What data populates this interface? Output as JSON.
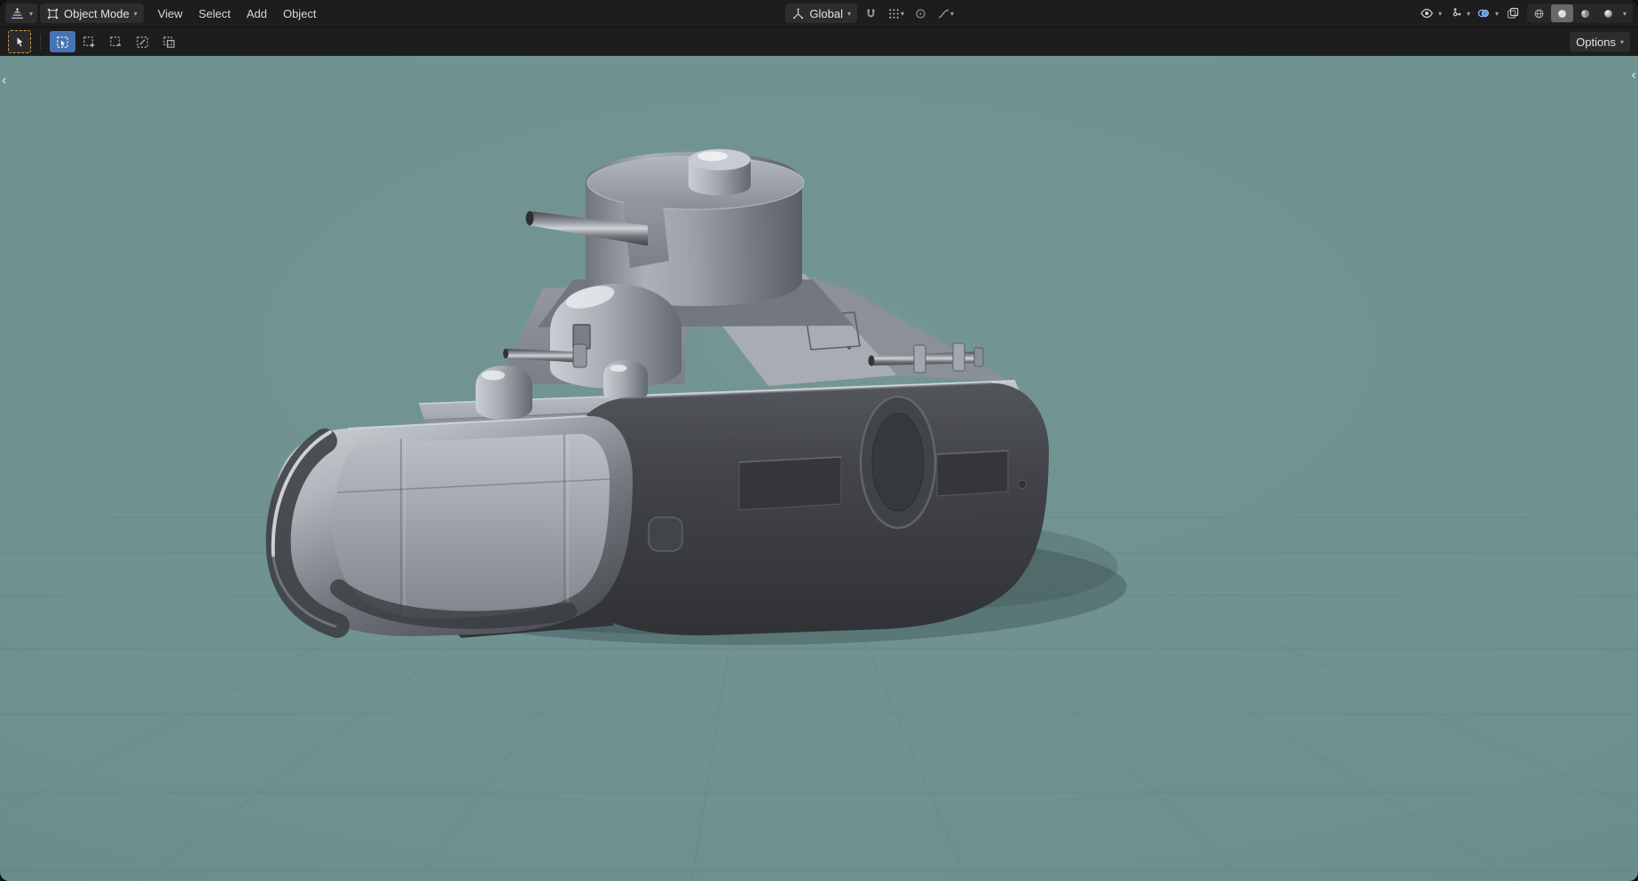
{
  "colors": {
    "header_bg": "#1d1d1d",
    "button_bg": "#2d2d2d",
    "text": "#dcdcdc",
    "accent_blue": "#4772b3",
    "active_tool_outline": "#c9a64b",
    "overlay_icon_blue": "#5e97dd",
    "viewport_bg": "#6d9190"
  },
  "header": {
    "mode_label": "Object Mode",
    "menus": [
      {
        "label": "View"
      },
      {
        "label": "Select"
      },
      {
        "label": "Add"
      },
      {
        "label": "Object"
      }
    ],
    "orientation_label": "Global"
  },
  "tool_settings": {
    "options_label": "Options",
    "select_modes": [
      "new",
      "extend",
      "subtract",
      "invert",
      "intersect"
    ],
    "active_select_mode": "new"
  },
  "icons": {
    "chevron_down": "▾",
    "region_toggle_left": "‹",
    "region_toggle_right": "‹",
    "editor_type": "3d-viewport-grid",
    "object_mode": "square-with-corner-dots",
    "orientation": "three-axes",
    "snap_magnet": "magnet",
    "snap_with": "grid-of-dots",
    "proportional_editing": "circle-with-dot",
    "falloff": "ease-curve",
    "visibility": "eye",
    "gizmos": "arrows-gizmo",
    "overlays": "two-overlapping-circles",
    "xray": "overlapping-squares",
    "shading_wireframe": "wireframe-sphere",
    "shading_solid": "solid-sphere",
    "shading_material": "material-sphere",
    "shading_rendered": "rendered-sphere",
    "active_tool": "tweak-cursor"
  },
  "viewport": {
    "content": "Low-poly gray tank 3D model in three-quarter view on a teal background with a faint floor grid",
    "selected_shading_mode": "solid",
    "overlays_enabled": true
  }
}
